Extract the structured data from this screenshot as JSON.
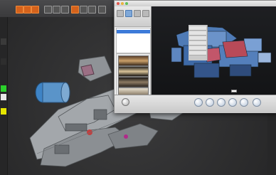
{
  "colors": {
    "background_app": "#2f2f30",
    "accent_orange": "#d4621c",
    "selection_blue": "#3d7bd9",
    "render_background": "#17181a"
  },
  "background_app": {
    "toolbar_icons": [
      "orange-tool-icon",
      "orange-tool-icon",
      "orange-tool-icon",
      "tool-icon",
      "tool-icon",
      "tool-icon",
      "tool-icon",
      "tool-icon",
      "tool-icon",
      "tool-icon"
    ]
  },
  "mac_window": {
    "title": "",
    "browser": {
      "icons": [
        "object-icon",
        "camera-icon",
        "render-icon",
        "settings-icon"
      ],
      "tree_items": [
        {
          "label": "",
          "selected": true
        },
        {
          "label": "",
          "selected": false
        },
        {
          "label": "",
          "selected": false
        },
        {
          "label": "",
          "selected": false
        }
      ],
      "thumbnail_count": 6
    },
    "render": {
      "caption": ""
    },
    "bottom_toolbar": {
      "buttons": [
        {
          "icon": "render-button-icon",
          "label": ""
        },
        {
          "icon": "camera-button-icon",
          "label": ""
        },
        {
          "icon": "light-button-icon",
          "label": ""
        },
        {
          "icon": "environment-button-icon",
          "label": ""
        },
        {
          "icon": "material-button-icon",
          "label": ""
        },
        {
          "icon": "share-button-icon",
          "label": ""
        }
      ]
    }
  }
}
